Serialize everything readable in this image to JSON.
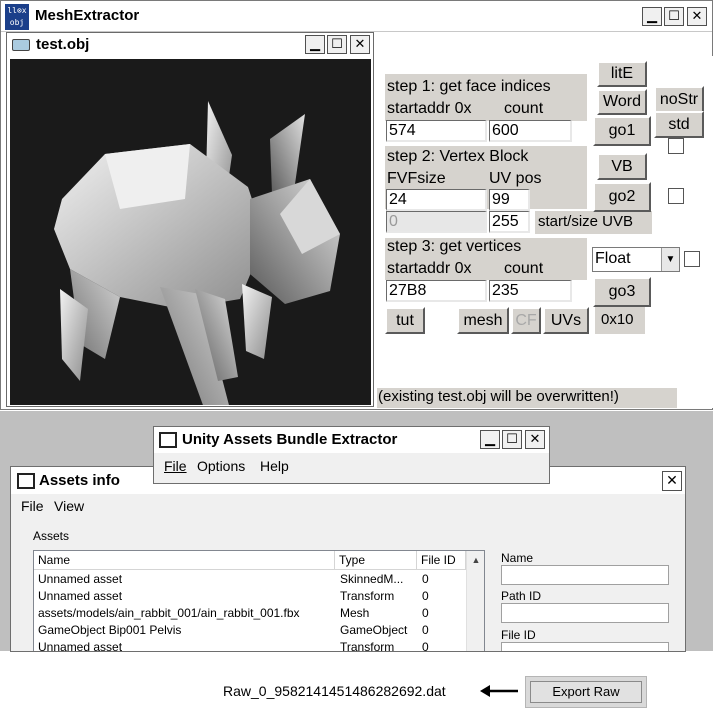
{
  "app": {
    "icon_text": "ll⊗x obj",
    "title": "MeshExtractor",
    "controls": {
      "minimize": "▁",
      "maximize": "☐",
      "close": "✕"
    }
  },
  "child_window": {
    "title": "test.obj"
  },
  "step1": {
    "title": "step 1: get face indices",
    "label_startaddr": "startaddr 0x",
    "label_count": "count",
    "startaddr": "574",
    "count": "600"
  },
  "step2": {
    "title": "step 2: Vertex Block",
    "label_fvf": "FVFsize",
    "label_uvpos": "UV pos",
    "fvfsize": "24",
    "uvpos": "99",
    "uv_start": "0",
    "uv_size": "255",
    "label_uvb": "start/size UVB"
  },
  "step3": {
    "title": "step 3: get vertices",
    "label_startaddr": "startaddr 0x",
    "label_count": "count",
    "startaddr": "27B8",
    "count": "235",
    "format_selected": "Float"
  },
  "buttons": {
    "lite": "litE",
    "word": "Word",
    "nostr": "noStr",
    "std": "std",
    "go1": "go1",
    "vb": "VB",
    "go2": "go2",
    "go3": "go3",
    "tut": "tut",
    "mesh": "mesh",
    "cf": "CF",
    "uvs": "UVs",
    "hex": "0x10"
  },
  "warning": "(existing test.obj will be overwritten!)",
  "uabe": {
    "title": "Unity Assets Bundle Extractor",
    "menu": [
      "File",
      "Options",
      "Help"
    ]
  },
  "assets_info": {
    "title": "Assets info",
    "menu": [
      "File",
      "View"
    ],
    "group_label": "Assets",
    "columns": [
      "Name",
      "Type",
      "File ID"
    ],
    "rows": [
      {
        "name": "Unnamed asset",
        "type": "SkinnedM...",
        "file_id": "0"
      },
      {
        "name": "Unnamed asset",
        "type": "Transform",
        "file_id": "0"
      },
      {
        "name": "assets/models/ain_rabbit_001/ain_rabbit_001.fbx",
        "type": "Mesh",
        "file_id": "0"
      },
      {
        "name": "GameObject Bip001 Pelvis",
        "type": "GameObject",
        "file_id": "0"
      },
      {
        "name": "Unnamed asset",
        "type": "Transform",
        "file_id": "0"
      }
    ],
    "side_labels": {
      "name": "Name",
      "path_id": "Path ID",
      "file_id": "File ID"
    }
  },
  "export": {
    "filename": "Raw_0_9582141451486282692.dat",
    "button_label": "Export Raw"
  }
}
